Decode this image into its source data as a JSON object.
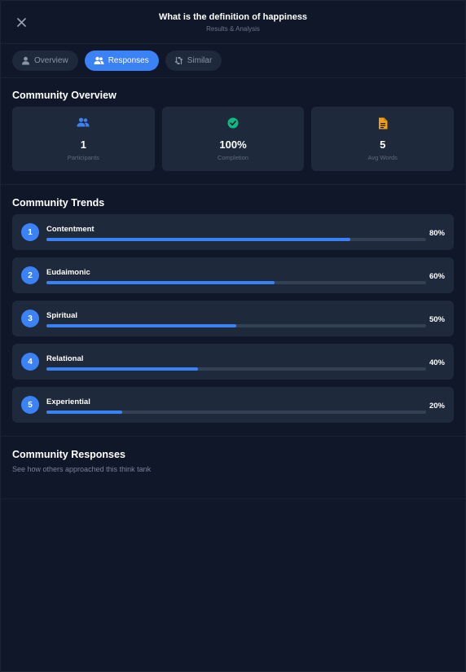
{
  "header": {
    "title": "What is the definition of happiness",
    "subtitle": "Results & Analysis",
    "close_icon": "close-icon"
  },
  "tabs": [
    {
      "label": "Overview",
      "icon": "user-icon",
      "active": false
    },
    {
      "label": "Responses",
      "icon": "users-icon",
      "active": true
    },
    {
      "label": "Similar",
      "icon": "compare-icon",
      "active": false
    }
  ],
  "overview": {
    "title": "Community Overview",
    "stats": [
      {
        "value": "1",
        "label": "Participants",
        "icon": "users-icon",
        "color": "#3b82f6"
      },
      {
        "value": "100%",
        "label": "Completion",
        "icon": "check-circle-icon",
        "color": "#10b981"
      },
      {
        "value": "5",
        "label": "Avg Words",
        "icon": "document-icon",
        "color": "#f59e0b"
      }
    ]
  },
  "trends": {
    "title": "Community Trends",
    "items": [
      {
        "rank": "1",
        "name": "Contentment",
        "percent_label": "80%",
        "percent": 80
      },
      {
        "rank": "2",
        "name": "Eudaimonic",
        "percent_label": "60%",
        "percent": 60
      },
      {
        "rank": "3",
        "name": "Spiritual",
        "percent_label": "50%",
        "percent": 50
      },
      {
        "rank": "4",
        "name": "Relational",
        "percent_label": "40%",
        "percent": 40
      },
      {
        "rank": "5",
        "name": "Experiential",
        "percent_label": "20%",
        "percent": 20
      }
    ]
  },
  "responses": {
    "title": "Community Responses",
    "subtitle": "See how others approached this think tank"
  },
  "colors": {
    "background": "#0f1729",
    "card": "#1e293b",
    "accent": "#3b82f6",
    "success": "#10b981",
    "warning": "#f59e0b"
  }
}
